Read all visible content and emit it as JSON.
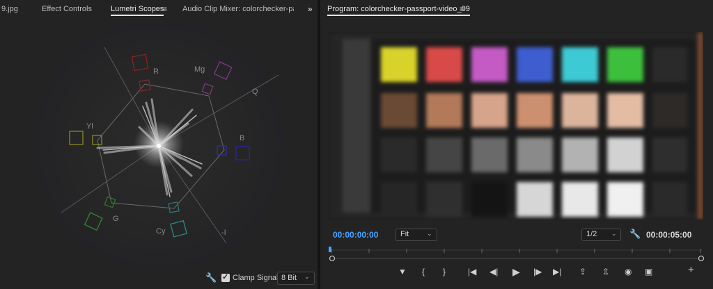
{
  "left_panel": {
    "tabs": [
      {
        "label": "9.jpg"
      },
      {
        "label": "Effect Controls"
      },
      {
        "label": "Lumetri Scopes"
      },
      {
        "label": "Audio Clip Mixer: colorchecker-passp"
      }
    ],
    "active_tab_menu_icon": "≡",
    "overflow_icon": "»",
    "scope_labels": {
      "r": "R",
      "mg": "Mg",
      "q": "Q",
      "yl": "Yl",
      "b": "B",
      "g": "G",
      "cy": "Cy",
      "i": "-I"
    },
    "clamp_signal_label": "Clamp Signal",
    "clamp_signal_checked": true,
    "bit_depth_value": "8 Bit"
  },
  "right_panel": {
    "title": "Program: colorchecker-passport-video_09",
    "title_menu_icon": "≡",
    "current_timecode": "00:00:00:00",
    "duration_timecode": "00:00:05:00",
    "zoom_value": "Fit",
    "resolution_value": "1/2",
    "transport": {
      "marker": "▼",
      "mark_in": "{",
      "mark_out": "}",
      "go_to_in": "|◀",
      "step_back": "◀|",
      "play": "▶",
      "step_forward": "|▶",
      "go_to_out": "▶|",
      "lift": "⇪",
      "extract": "⇫",
      "export_frame": "◉",
      "compare": "▣",
      "add": "+"
    }
  },
  "colors": {
    "accent_timecode": "#4aa3ff",
    "panel_bg": "#232323"
  }
}
